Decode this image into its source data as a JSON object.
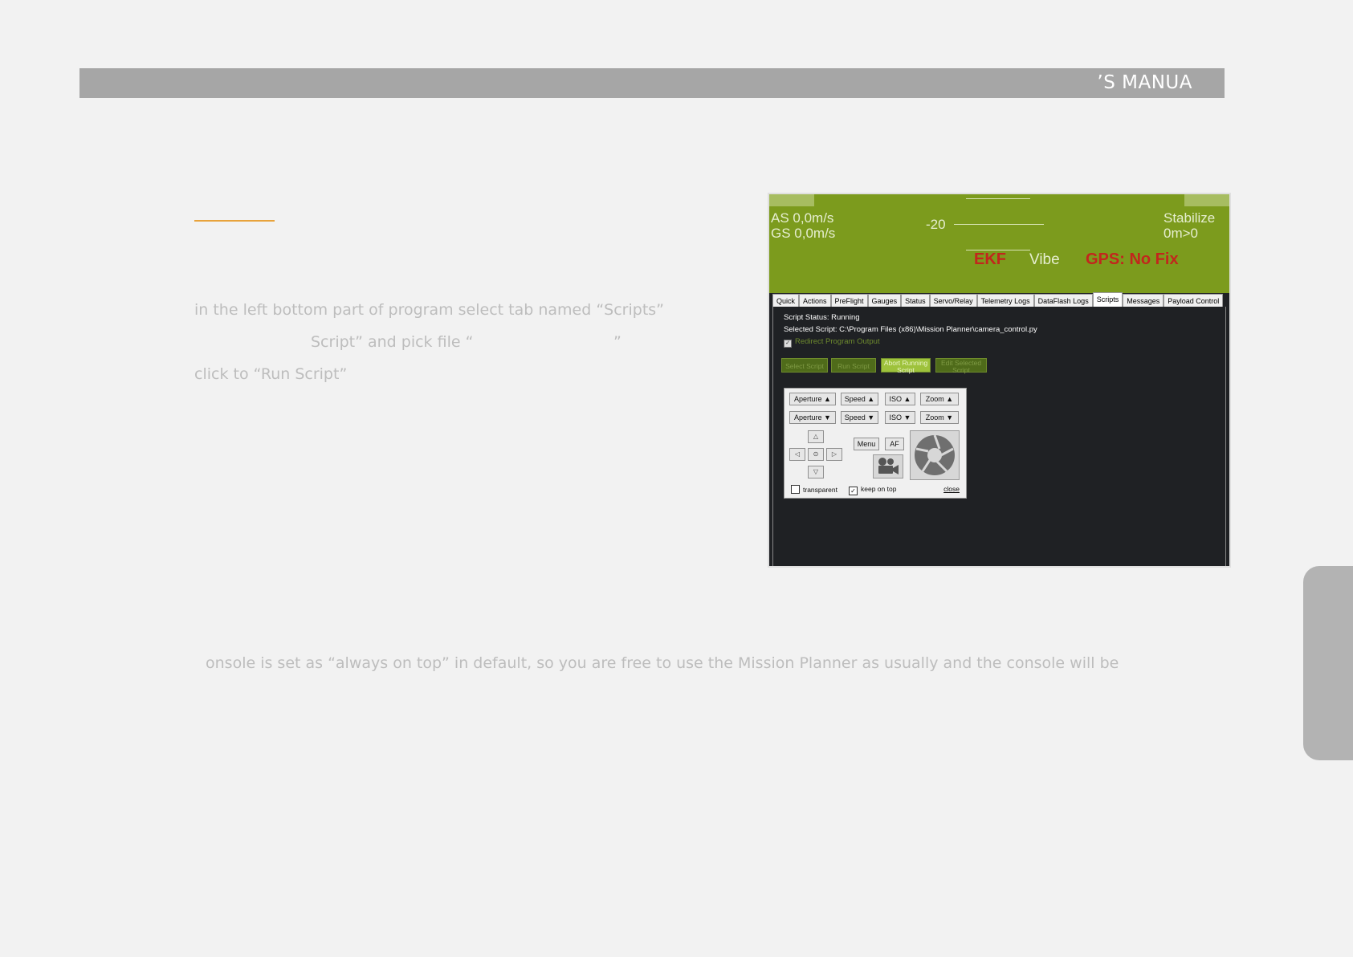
{
  "header": {
    "title": "’S MANUA"
  },
  "steps": [
    "in the left bottom part of program select tab named “Scripts”",
    "Script” and pick file “",
    "”",
    "click to “Run Script”"
  ],
  "footer_note": "onsole is set as “always on top” in default, so you are free to use the Mission Planner as usually and the console will be",
  "screenshot": {
    "hud": {
      "as": "AS 0,0m/s",
      "gs": "GS 0,0m/s",
      "pitch": "-20",
      "mode": "Stabilize",
      "dist": "0m>0",
      "ekf": "EKF",
      "vibe": "Vibe",
      "gps": "GPS: No Fix"
    },
    "tabs": [
      "Quick",
      "Actions",
      "PreFlight",
      "Gauges",
      "Status",
      "Servo/Relay",
      "Telemetry Logs",
      "DataFlash Logs",
      "Scripts",
      "Messages",
      "Payload Control"
    ],
    "active_tab": "Scripts",
    "script_status": "Script Status: Running",
    "selected_script": "Selected Script: C:\\Program Files (x86)\\Mission Planner\\camera_control.py",
    "redirect_label": "Redirect Program Output",
    "buttons": {
      "select": "Select Script",
      "run": "Run Script",
      "abort_1": "Abort Running",
      "abort_2": "Script",
      "edit_1": "Edit Selected",
      "edit_2": "Script"
    },
    "console": {
      "aperture_up": "Aperture ▲",
      "speed_up": "Speed ▲",
      "iso_up": "ISO ▲",
      "zoom_up": "Zoom ▲",
      "aperture_down": "Aperture ▼",
      "speed_down": "Speed ▼",
      "iso_down": "ISO ▼",
      "zoom_down": "Zoom ▼",
      "arrow_up": "△",
      "arrow_left": "◁",
      "center": "⊙",
      "arrow_right": "▷",
      "arrow_down": "▽",
      "menu": "Menu",
      "af": "AF",
      "transparent": "transparent",
      "keep_on_top": "keep on top",
      "close": "close"
    }
  },
  "colors": {
    "accent": "#e8a33c",
    "header": "#a6a6a6",
    "hud_green": "#7c9b1d",
    "warning_red": "#c2261d"
  }
}
